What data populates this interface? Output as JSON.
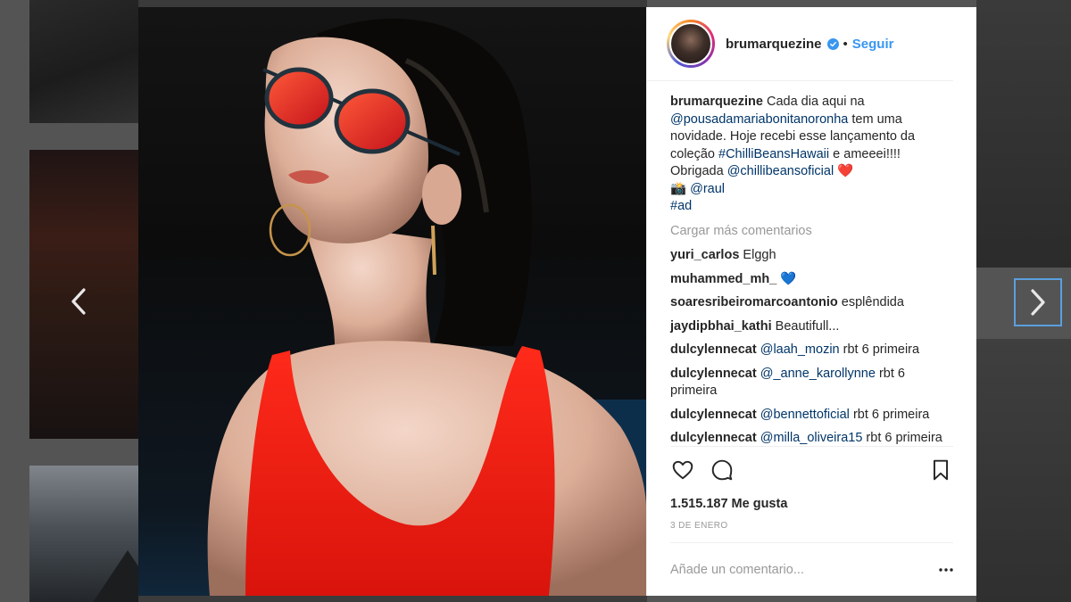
{
  "post": {
    "username": "brumarquezine",
    "separator": "•",
    "follow_label": "Seguir",
    "caption": {
      "text_1": "Cada dia aqui na",
      "mention_1": "@pousadamariabonitanoronha",
      "text_2": "tem uma novidade. Hoje recebi esse lançamento da coleção",
      "hashtag_1": "#ChilliBeansHawaii",
      "text_3": "e ameeei!!!! Obrigada",
      "mention_2": "@chillibeansoficial",
      "emoji_heart": "❤️",
      "emoji_camera": "📸",
      "mention_3": "@raul",
      "hashtag_2": "#ad"
    },
    "load_more_label": "Cargar más comentarios",
    "comments": [
      {
        "user": "yuri_carlos",
        "text": "Elggh"
      },
      {
        "user": "muhammed_mh_",
        "text": "💙"
      },
      {
        "user": "soaresribeiromarcoantonio",
        "text": "esplêndida"
      },
      {
        "user": "jaydipbhai_kathi",
        "text": "Beautifull..."
      },
      {
        "user": "dulcylennecat",
        "mention": "@laah_mozin",
        "text": "rbt 6 primeira"
      },
      {
        "user": "dulcylennecat",
        "mention": "@_anne_karollynne",
        "text": "rbt 6 primeira"
      },
      {
        "user": "dulcylennecat",
        "mention": "@bennettoficial",
        "text": "rbt 6 primeira"
      },
      {
        "user": "dulcylennecat",
        "mention": "@milla_oliveira15",
        "text": "rbt 6 primeira"
      }
    ],
    "likes_label": "1.515.187 Me gusta",
    "date_label": "3 DE ENERO",
    "add_comment_placeholder": "Añade un comentario...",
    "colors": {
      "link": "#003569",
      "follow": "#3897f0",
      "muted": "#999999",
      "nav_focus": "#5b9fe0"
    },
    "icons": {
      "prev": "chevron-left-icon",
      "next": "chevron-right-icon",
      "like": "heart-outline-icon",
      "comment": "speech-bubble-icon",
      "save": "bookmark-icon",
      "more": "ellipsis-icon",
      "verified": "verified-badge-icon"
    }
  }
}
